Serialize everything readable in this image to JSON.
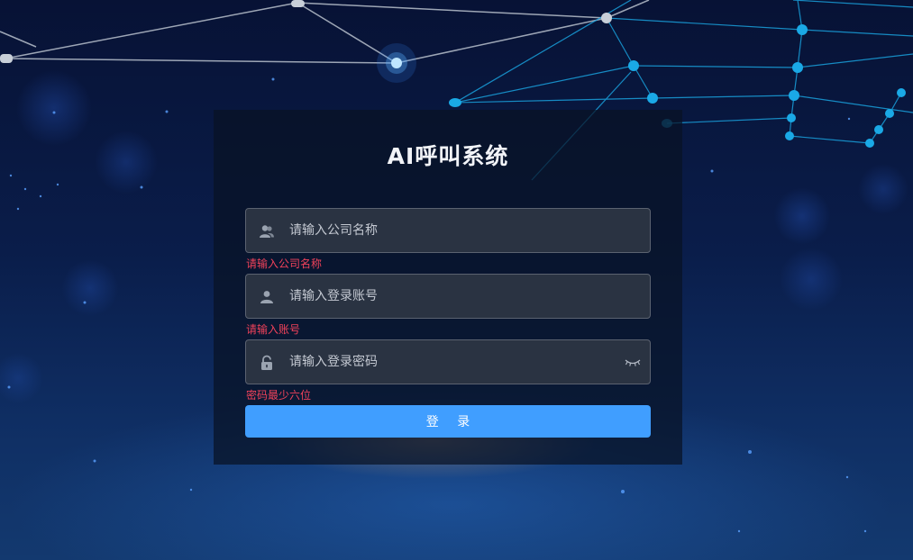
{
  "app": {
    "title": "AI呼叫系统"
  },
  "form": {
    "company": {
      "placeholder": "请输入公司名称",
      "value": "",
      "error": "请输入公司名称",
      "icon": "users-icon"
    },
    "account": {
      "placeholder": "请输入登录账号",
      "value": "",
      "error": "请输入账号",
      "icon": "user-icon"
    },
    "password": {
      "placeholder": "请输入登录密码",
      "value": "",
      "error": "密码最少六位",
      "icon": "lock-icon",
      "toggle_icon": "eye-closed-icon"
    },
    "submit_label": "登 录"
  },
  "colors": {
    "accent": "#409eff",
    "error": "#f0425a",
    "panel": "#081224",
    "field_bg": "#2a3342",
    "network_cyan": "#1aa9e6",
    "network_white": "#c8cfd8"
  }
}
